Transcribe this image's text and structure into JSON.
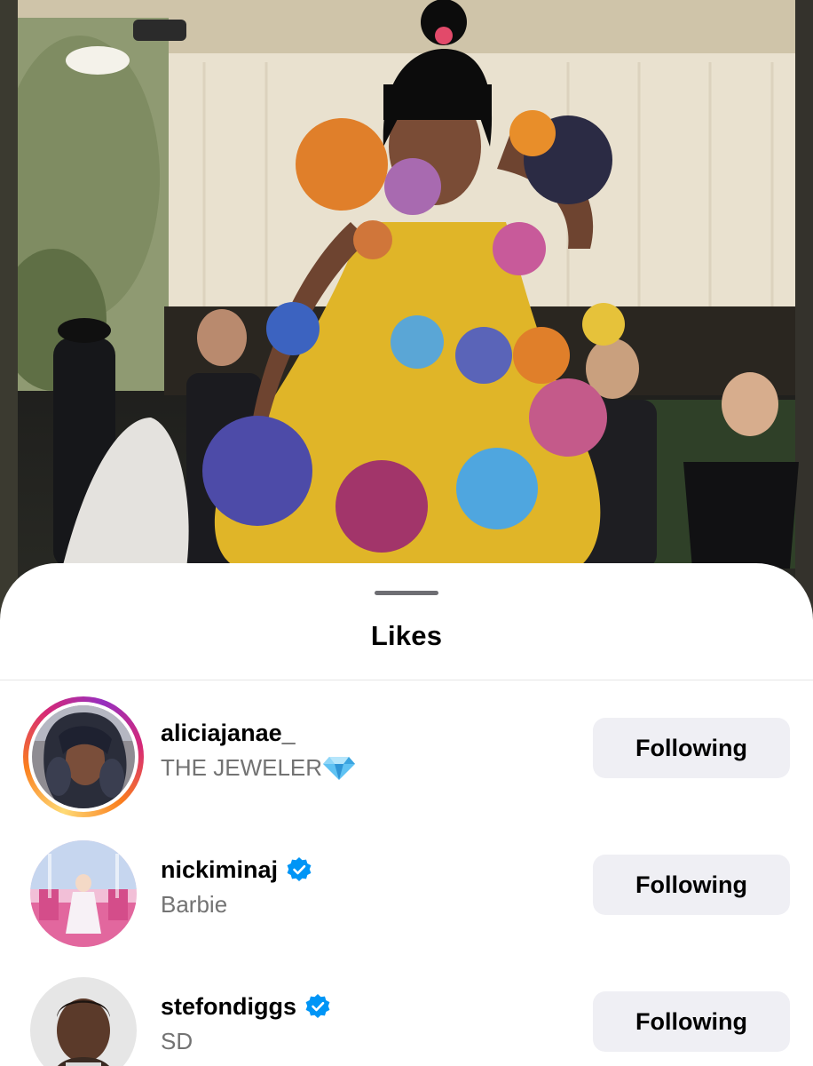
{
  "background": {
    "photo_icon": "post-photo"
  },
  "sheet": {
    "title": "Likes"
  },
  "likes": [
    {
      "username": "aliciajanae_",
      "subtitle": "THE JEWELER",
      "subtitle_emoji_icon": "gem-icon",
      "has_story_ring": true,
      "verified": false,
      "button_label": "Following"
    },
    {
      "username": "nickiminaj",
      "subtitle": "Barbie",
      "has_story_ring": false,
      "verified": true,
      "button_label": "Following"
    },
    {
      "username": "stefondiggs",
      "subtitle": "SD",
      "has_story_ring": false,
      "verified": true,
      "button_label": "Following"
    }
  ],
  "colors": {
    "verified_blue": "#0095f6",
    "button_bg": "#efeff4",
    "subtitle_gray": "#737373"
  }
}
